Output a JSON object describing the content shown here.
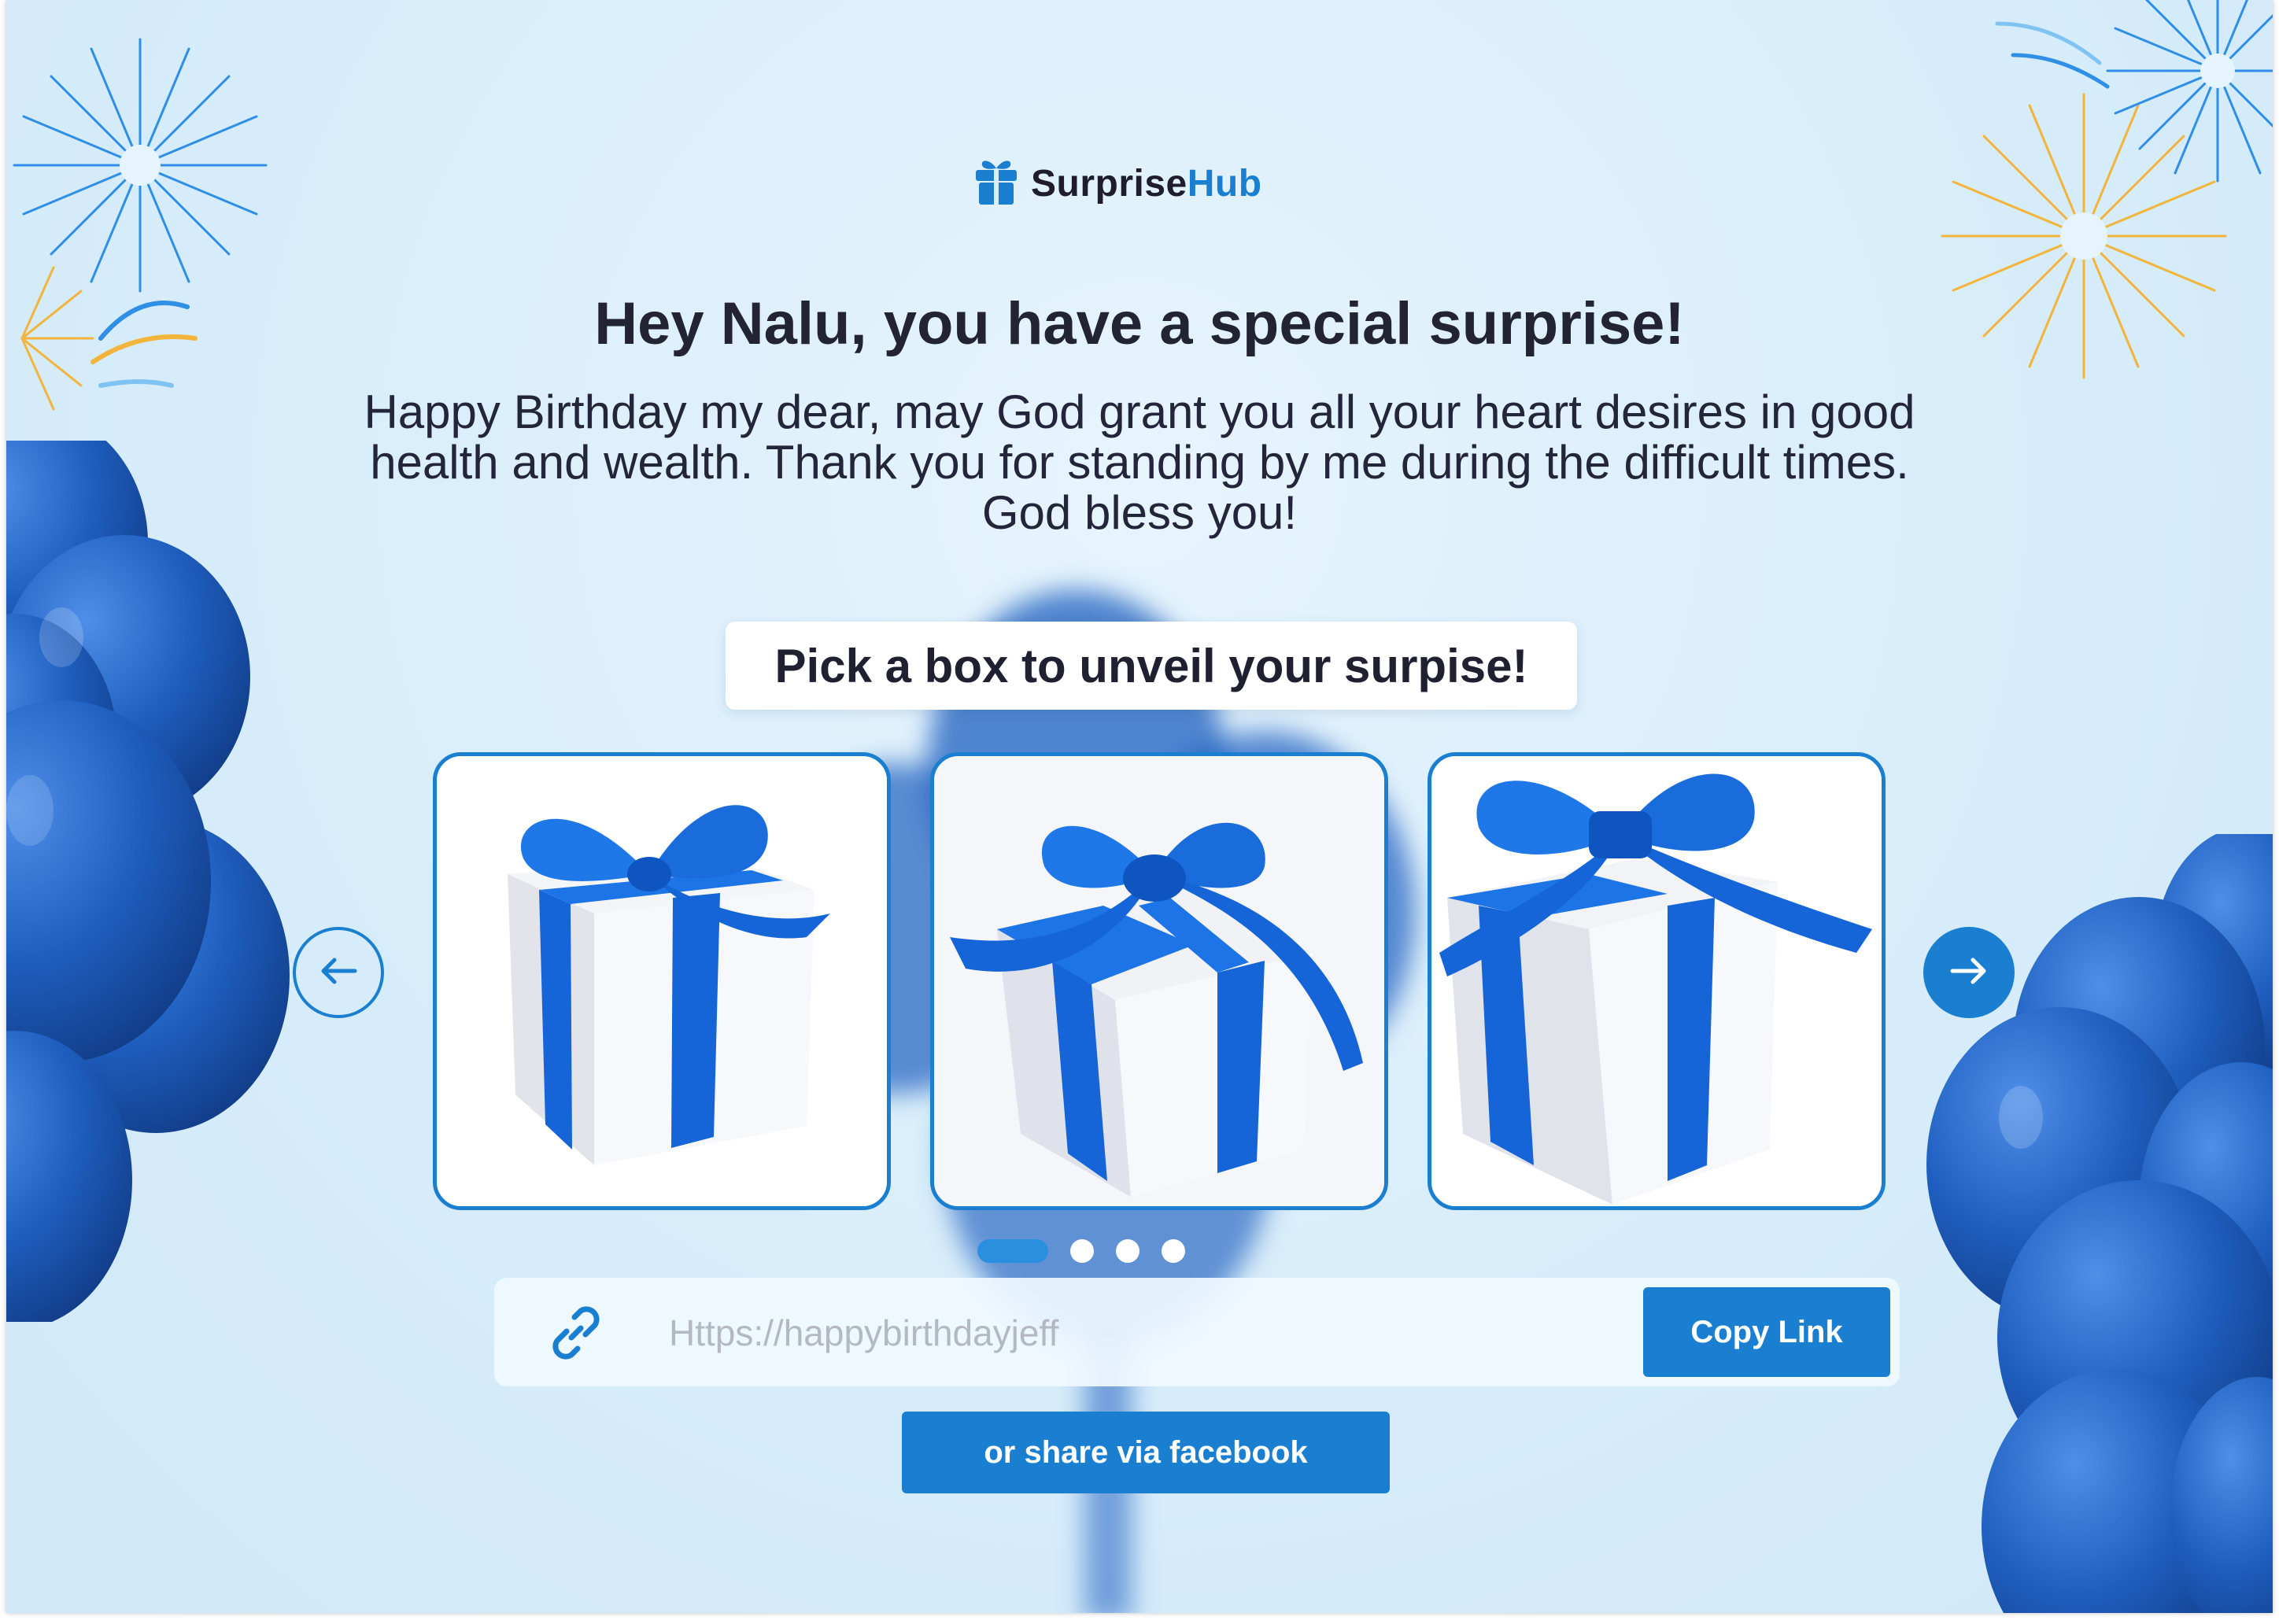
{
  "brand": {
    "name_part1": "Surprise",
    "name_part2": "Hub",
    "logo_icon": "gift-icon"
  },
  "greeting": {
    "headline": "Hey Nalu, you have a special surprise!",
    "message": "Happy Birthday my dear, may God grant you all your heart desires in good health and wealth. Thank you for standing by me during the difficult times. God bless you!"
  },
  "picker": {
    "label": "Pick a box to unveil your surpise!",
    "prev_icon": "arrow-left-icon",
    "next_icon": "arrow-right-icon",
    "boxes": [
      {
        "id": "gift-box-1",
        "icon": "gift-box-image"
      },
      {
        "id": "gift-box-2",
        "icon": "gift-box-image"
      },
      {
        "id": "gift-box-3",
        "icon": "gift-box-image"
      }
    ],
    "pagination": {
      "total": 4,
      "active": 0
    }
  },
  "share": {
    "link_placeholder": "Https://happybirthdayjeff",
    "link_icon": "link-icon",
    "copy_label": "Copy Link",
    "facebook_label": "or share via facebook"
  },
  "colors": {
    "accent": "#1a7fd0",
    "background": "#d9eefb",
    "balloon": "#1e5fbf",
    "firework_blue": "#2f8fe6",
    "firework_gold": "#f2b43a",
    "heading_text": "#222433"
  }
}
